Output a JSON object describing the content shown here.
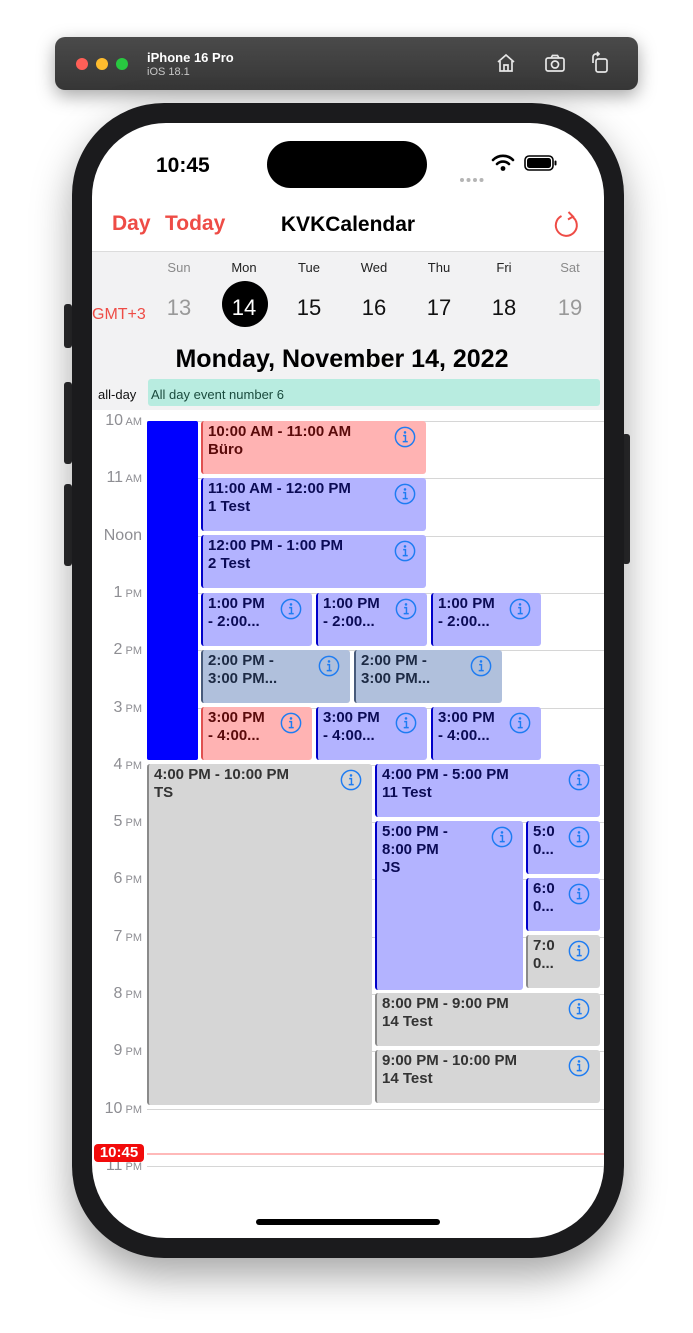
{
  "simulator": {
    "device_name": "iPhone 16 Pro",
    "os_version": "iOS 18.1",
    "icons": [
      "home-icon",
      "screenshot-icon",
      "rotate-icon"
    ]
  },
  "status_bar": {
    "time": "10:45",
    "icons": [
      "signal-dots-icon",
      "wifi-icon",
      "battery-icon"
    ]
  },
  "nav": {
    "left_label": "Day",
    "today_label": "Today",
    "title": "KVKCalendar",
    "reload_icon": "reload-icon"
  },
  "week": {
    "days": [
      {
        "name": "Sun",
        "num": "13"
      },
      {
        "name": "Mon",
        "num": "14"
      },
      {
        "name": "Tue",
        "num": "15"
      },
      {
        "name": "Wed",
        "num": "16"
      },
      {
        "name": "Thu",
        "num": "17"
      },
      {
        "name": "Fri",
        "num": "18"
      },
      {
        "name": "Sat",
        "num": "19"
      }
    ],
    "selected_day": "14",
    "timezone": "GMT+3"
  },
  "date_title": "Monday, November 14, 2022",
  "all_day": {
    "label": "all-day",
    "event": "All day event number 6"
  },
  "hours": [
    {
      "n": "10",
      "ampm": "AM"
    },
    {
      "n": "11",
      "ampm": "AM"
    },
    {
      "n": "Noon",
      "ampm": ""
    },
    {
      "n": "1",
      "ampm": "PM"
    },
    {
      "n": "2",
      "ampm": "PM"
    },
    {
      "n": "3",
      "ampm": "PM"
    },
    {
      "n": "4",
      "ampm": "PM"
    },
    {
      "n": "5",
      "ampm": "PM"
    },
    {
      "n": "6",
      "ampm": "PM"
    },
    {
      "n": "7",
      "ampm": "PM"
    },
    {
      "n": "8",
      "ampm": "PM"
    },
    {
      "n": "9",
      "ampm": "PM"
    },
    {
      "n": "10",
      "ampm": "PM"
    },
    {
      "n": "11",
      "ampm": "PM"
    }
  ],
  "events": [
    {
      "text": "10:00 AM - 11:00 AM\nBüro",
      "color": "pink"
    },
    {
      "text": "11:00 AM - 12:00 PM\n1 Test",
      "color": "blue"
    },
    {
      "text": "12:00 PM - 1:00 PM\n2 Test",
      "color": "blue"
    },
    {
      "text": "1:00 PM\n- 2:00...",
      "color": "blue"
    },
    {
      "text": "1:00 PM\n- 2:00...",
      "color": "blue"
    },
    {
      "text": "1:00 PM\n- 2:00...",
      "color": "blue"
    },
    {
      "text": "2:00 PM -\n3:00 PM...",
      "color": "steel"
    },
    {
      "text": "2:00 PM -\n3:00 PM...",
      "color": "steel"
    },
    {
      "text": "3:00 PM\n- 4:00...",
      "color": "pink"
    },
    {
      "text": "3:00 PM\n- 4:00...",
      "color": "blue"
    },
    {
      "text": "3:00 PM\n- 4:00...",
      "color": "blue"
    },
    {
      "text": "4:00 PM - 10:00 PM\nTS",
      "color": "gray"
    },
    {
      "text": "4:00 PM - 5:00 PM\n11 Test",
      "color": "blue"
    },
    {
      "text": "5:00 PM -\n8:00 PM\nJS",
      "color": "blue"
    },
    {
      "text": "5:0\n0...",
      "color": "blue"
    },
    {
      "text": "6:0\n0...",
      "color": "blue"
    },
    {
      "text": "7:0\n0...",
      "color": "gray"
    },
    {
      "text": "8:00 PM - 9:00 PM\n14 Test",
      "color": "gray"
    },
    {
      "text": "9:00 PM - 10:00 PM\n14 Test",
      "color": "gray"
    }
  ],
  "current_time_badge": "10:45",
  "colors": {
    "accent": "#ee4c46",
    "pink_bg": "#ffb3b3",
    "pink_border": "#e05050",
    "pink_text": "#5a0a0a",
    "blue_bg": "#b3b3ff",
    "blue_border": "#0000c8",
    "blue_text": "#0b0b55",
    "steel_bg": "#b0c0dc",
    "steel_border": "#485a7a",
    "steel_text": "#1d2a44",
    "gray_bg": "#d6d6d6",
    "gray_border": "#8a8a8a",
    "gray_text": "#333333",
    "blue_bar": "#0000ff",
    "info": "#1e7cf2"
  }
}
